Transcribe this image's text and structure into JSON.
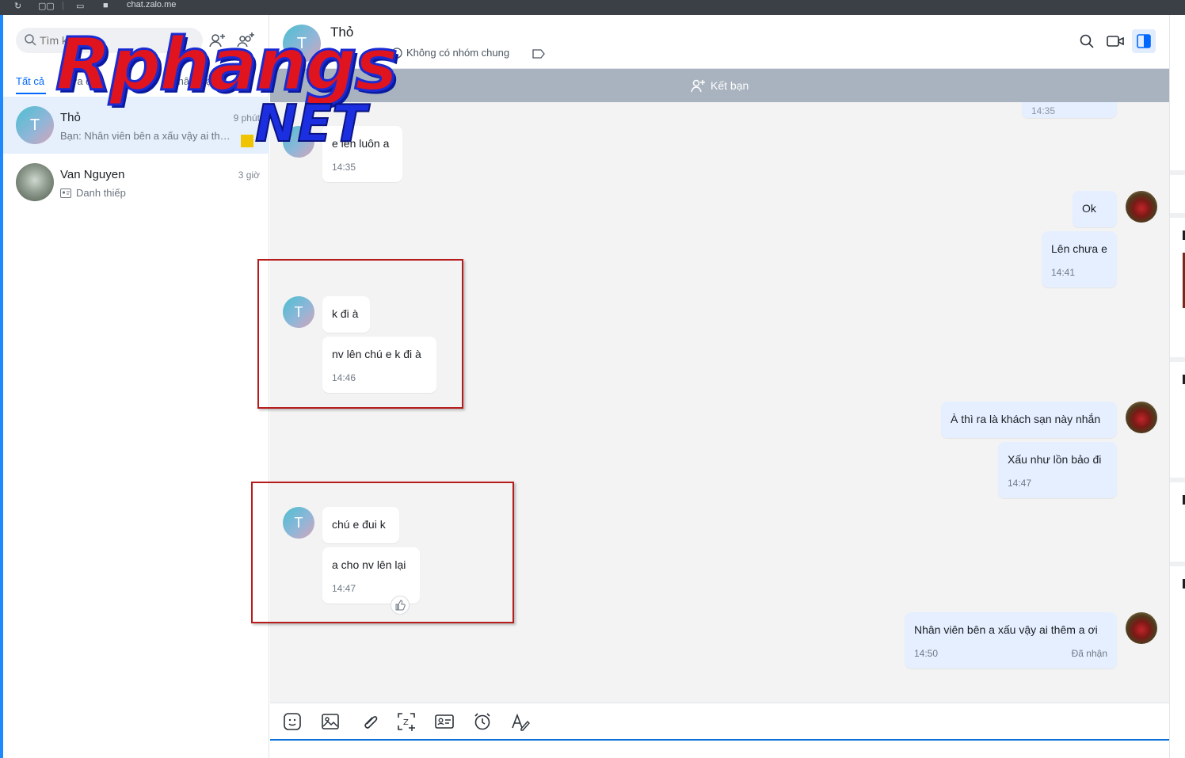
{
  "browser": {
    "url": "chat.zalo.me"
  },
  "watermark": {
    "line1": "Rphangs",
    "line2": "NET"
  },
  "sidebar": {
    "search": {
      "placeholder": "Tìm kiếm"
    },
    "tabs": [
      {
        "label": "Tất cả"
      },
      {
        "label": "Chưa đọc"
      },
      {
        "label": "Phân loại"
      }
    ],
    "conversations": [
      {
        "initial": "T",
        "name": "Thỏ",
        "time": "9 phút",
        "preview": "Bạn: Nhân viên bên a xấu vậy ai thêm a ơi"
      },
      {
        "name": "Van Nguyen",
        "time": "3 giờ",
        "preview": "Danh thiếp"
      }
    ]
  },
  "chat": {
    "contact_initial": "T",
    "contact_name": "Thỏ",
    "subtitle": "Không có nhóm chung",
    "friend_bar_label": "Kết bạn",
    "messages": [
      {
        "text": "14:35"
      },
      {
        "text": "e lên luôn a",
        "time": "14:35"
      },
      {
        "text": "Ok"
      },
      {
        "text": "Lên chưa e",
        "time": "14:41"
      },
      {
        "text": "k đi à"
      },
      {
        "text": "nv lên chú e k đi à",
        "time": "14:46"
      },
      {
        "text": "À thì ra là khách sạn này nhắn"
      },
      {
        "text": "Xấu như lồn bảo đi",
        "time": "14:47"
      },
      {
        "text": "chú e đui k"
      },
      {
        "text": "a cho nv lên lại",
        "time": "14:47"
      },
      {
        "text": "Nhân viên bên a xấu vậy ai thêm a ơi",
        "time": "14:50",
        "status": "Đã nhận"
      }
    ]
  },
  "colors": {
    "accent": "#0068ff",
    "outgoing_bubble": "#e5efff",
    "highlight_box": "#b71c1c",
    "friend_bar": "#a8b3bf"
  }
}
